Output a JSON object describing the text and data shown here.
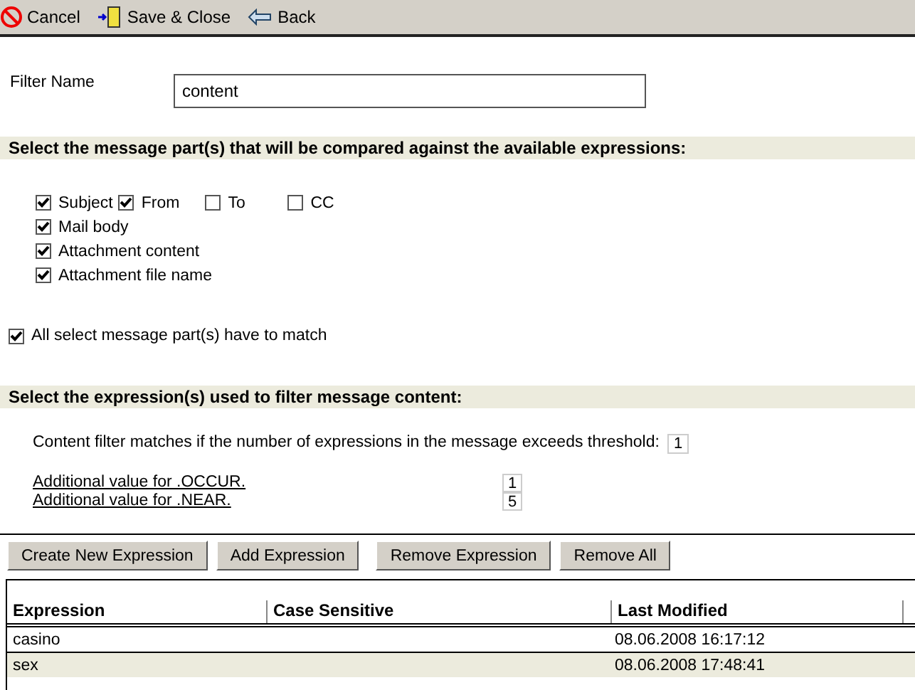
{
  "toolbar": [
    {
      "label": "Cancel",
      "kind": "cancel"
    },
    {
      "label": "Save & Close",
      "kind": "save"
    },
    {
      "label": "Back",
      "kind": "back"
    }
  ],
  "filter_name": {
    "label": "Filter Name",
    "value": "content"
  },
  "message_parts": {
    "heading": "Select the message part(s) that will be compared against the available expressions:",
    "rows": [
      [
        {
          "label": "Subject",
          "checked": true
        },
        {
          "label": "From",
          "checked": true
        },
        {
          "label": "To",
          "checked": false
        },
        {
          "label": "CC",
          "checked": false
        }
      ],
      [
        {
          "label": "Mail body",
          "checked": true
        }
      ],
      [
        {
          "label": "Attachment content",
          "checked": true
        }
      ],
      [
        {
          "label": "Attachment file name",
          "checked": true
        }
      ]
    ],
    "all_match": {
      "label": "All select message part(s) have to match",
      "checked": true
    }
  },
  "expressions": {
    "heading": "Select the expression(s) used to filter message content:",
    "threshold": {
      "label": "Content filter matches if the number of expressions in the message exceeds threshold:",
      "value": "1"
    },
    "additional": [
      {
        "label": "Additional value for .OCCUR.",
        "value": "1"
      },
      {
        "label": "Additional value for .NEAR.",
        "value": "5"
      }
    ],
    "buttons": [
      "Create New Expression",
      "Add Expression",
      "Remove Expression",
      "Remove All"
    ],
    "table": {
      "columns": [
        "Expression",
        "Case Sensitive",
        "Last Modified"
      ],
      "rows": [
        {
          "cells": [
            "casino",
            "",
            "08.06.2008 16:17:12"
          ],
          "selected": false
        },
        {
          "cells": [
            "sex",
            "",
            "08.06.2008 17:48:41"
          ],
          "selected": true
        }
      ]
    }
  }
}
